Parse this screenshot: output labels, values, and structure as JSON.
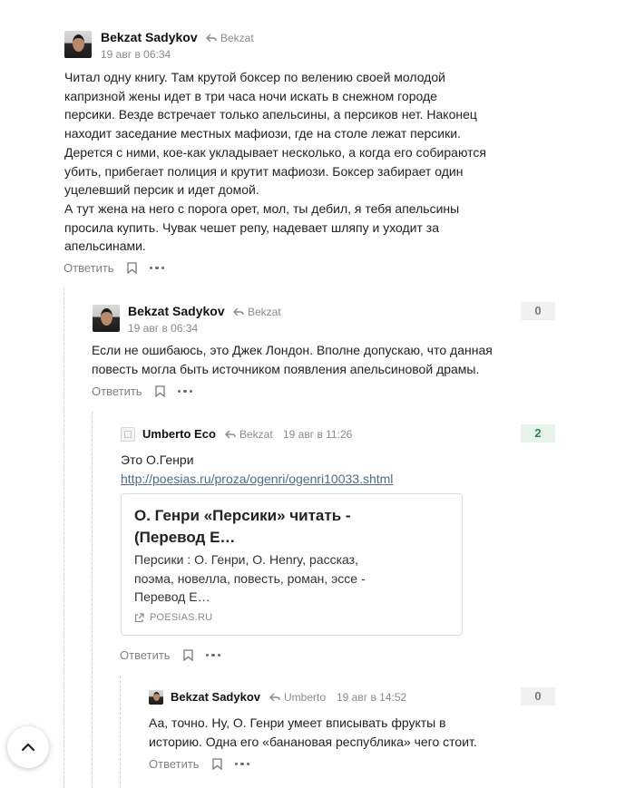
{
  "comments": [
    {
      "author": "Bekzat Sadykov",
      "reply_to": "Bekzat",
      "date": "19 авг в 06:34",
      "lines": [
        "Читал одну книгу. Там крутой боксер по велению своей молодой",
        "капризной жены идет в три часа ночи искать в снежном городе",
        "персики. Везде встречает только апельсины, а персиков нет. Наконец",
        "находит заседание местных мафиози, где на столе лежат персики.",
        "Дерется с ними, кое-как укладывает несколько, а когда его собираются",
        "убить, прибегает полиция и крутит мафиози. Боксер забирает один",
        "уцелевший персик и идет домой.",
        "А тут жена на него с порога орет, мол, ты дебил, я тебя апельсины",
        "просила купить. Чувак чешет репу, надевает шляпу и уходит за",
        "апельсинами."
      ],
      "reply_label": "Ответить"
    },
    {
      "author": "Bekzat Sadykov",
      "reply_to": "Bekzat",
      "date": "19 авг в 06:34",
      "score": "0",
      "lines": [
        "Если не ошибаюсь, это Джек Лондон. Вполне допускаю, что данная",
        "повесть могла быть источником появления апельсиновой драмы."
      ],
      "reply_label": "Ответить"
    },
    {
      "author": "Umberto Eco",
      "reply_to": "Bekzat",
      "date": "19 авг в 11:26",
      "score": "2",
      "text": "Это О.Генри",
      "link": "http://poesias.ru/proza/ogenri/ogenri10033.shtml",
      "preview": {
        "title_line1": "О. Генри «Персики» читать -",
        "title_line2": "(Перевод Е…",
        "desc_line1": "Персики : О. Генри, O. Henry, рассказ,",
        "desc_line2": "поэма, новелла, повесть, роман, эссе -",
        "desc_line3": "Перевод Е…",
        "domain": "POESIAS.RU"
      },
      "reply_label": "Ответить"
    },
    {
      "author": "Bekzat Sadykov",
      "reply_to": "Umberto",
      "date": "19 авг в 14:52",
      "score": "0",
      "lines": [
        "Аа, точно. Ну, О. Генри умеет вписывать фрукты в",
        "историю. Одна его «банановая республика» чего стоит."
      ],
      "reply_label": "Ответить"
    }
  ],
  "colors": {
    "positive_score": "#2e8b57",
    "neutral_score": "#7a7a7a",
    "link": "#4a6d8c",
    "meta": "#8a8a8a"
  },
  "icons": [
    "reply-arrow-icon",
    "bookmark-icon",
    "more-dots-icon",
    "external-link-icon",
    "chevron-up-icon"
  ]
}
